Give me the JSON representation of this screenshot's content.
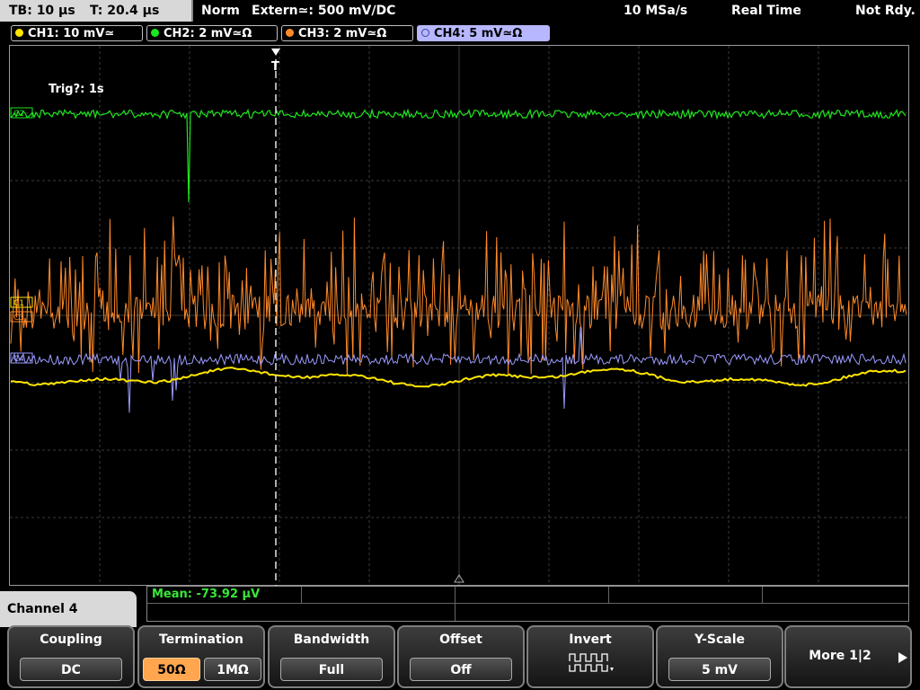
{
  "status": {
    "timebase": "TB: 10 µs",
    "trigger_time": "T: 20.4 µs",
    "trigger_mode": "Norm",
    "trigger_source": "Extern≃: 500 mV∕DC",
    "sample_rate": "10 MSa/s",
    "acq_mode": "Real Time",
    "run_state": "Not Rdy."
  },
  "channels": [
    {
      "label": "CH1: 10 mV≃",
      "color": "#ffe600",
      "dot": "filled"
    },
    {
      "label": "CH2: 2 mV≃Ω",
      "color": "#1de51d",
      "dot": "filled"
    },
    {
      "label": "CH3: 2 mV≃Ω",
      "color": "#ff8a2a",
      "dot": "filled"
    },
    {
      "label": "CH4: 5 mV≃Ω",
      "color": "#9b9bff",
      "dot": "hollow",
      "selected": true
    }
  ],
  "display": {
    "trigger_info": "Trig?: 1s",
    "markers": {
      "c1": "C1",
      "c2": "C2",
      "c3": "C3",
      "c4": "C4"
    },
    "trigger_marker": "T"
  },
  "measurement": {
    "text": "Mean: -73.92 µV",
    "color": "#39e639"
  },
  "menu": {
    "panel_title": "Channel 4",
    "coupling": {
      "title": "Coupling",
      "value": "DC"
    },
    "termination": {
      "title": "Termination",
      "opt1": "50Ω",
      "opt2": "1MΩ"
    },
    "bandwidth": {
      "title": "Bandwidth",
      "value": "Full"
    },
    "offset": {
      "title": "Offset",
      "value": "Off"
    },
    "invert": {
      "title": "Invert"
    },
    "yscale": {
      "title": "Y-Scale",
      "value": "5 mV"
    },
    "more": {
      "label": "More 1|2"
    }
  },
  "colors": {
    "ch1": "#ffe600",
    "ch2": "#1de51d",
    "ch3": "#ff8a2a",
    "ch4": "#9b9bff",
    "grid": "#5a5a5a"
  }
}
